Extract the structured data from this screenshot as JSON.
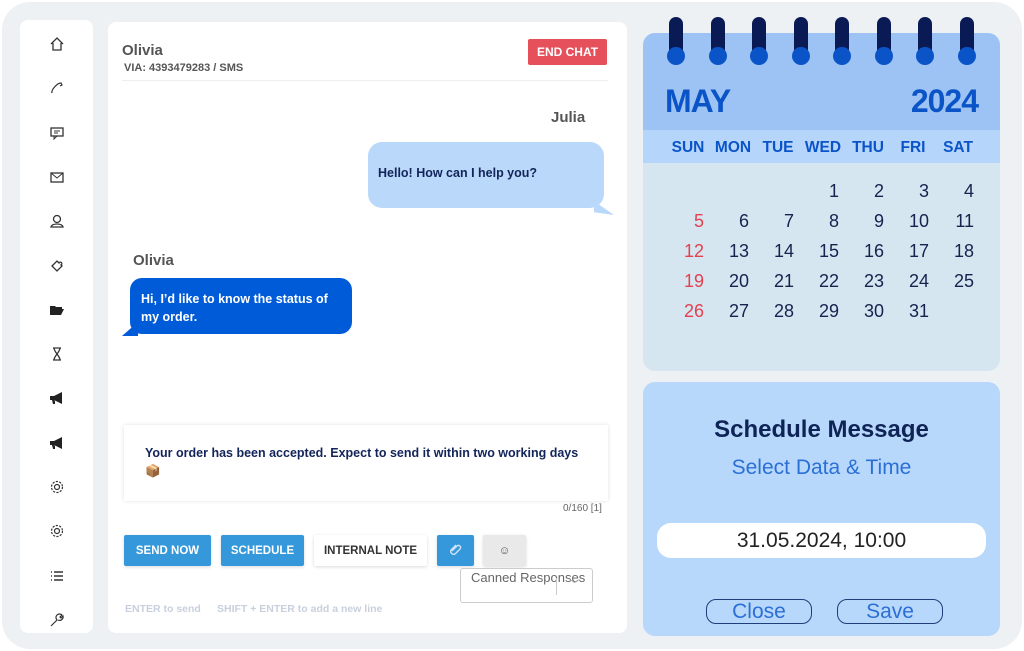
{
  "sidebar": {
    "items": [
      {
        "icon": "home-icon"
      },
      {
        "icon": "phone-icon"
      },
      {
        "icon": "chat-icon"
      },
      {
        "icon": "mail-icon"
      },
      {
        "icon": "user-icon"
      },
      {
        "icon": "puzzle-icon"
      },
      {
        "icon": "folder-open-icon"
      },
      {
        "icon": "hourglass-icon"
      },
      {
        "icon": "megaphone-icon"
      },
      {
        "icon": "megaphone-icon"
      },
      {
        "icon": "gear-icon"
      },
      {
        "icon": "gear-icon"
      },
      {
        "icon": "list-icon"
      },
      {
        "icon": "wrench-icon"
      }
    ]
  },
  "chat": {
    "contact_name": "Olivia",
    "via": "VIA:  4393479283 / SMS",
    "end_chat": "END CHAT",
    "messages": [
      {
        "sender": "Julia",
        "text": "Hello! How can I help you?"
      },
      {
        "sender": "Olivia",
        "text": "Hi, I’d like to know the status of my order."
      }
    ],
    "compose_text": "Your order has been accepted. Expect to send it within two working days📦",
    "counter": "0/160 [1]",
    "send_now": "SEND NOW",
    "schedule": "SCHEDULE",
    "internal_note": "INTERNAL NOTE",
    "canned_responses": "Canned Responses",
    "hint_enter": "ENTER to send",
    "hint_shift": "SHIFT + ENTER to add a new line"
  },
  "calendar": {
    "month": "MAY",
    "year": "2024",
    "weekdays": [
      "SUN",
      "MON",
      "TUE",
      "WED",
      "THU",
      "FRI",
      "SAT"
    ],
    "first_weekday_index": 3,
    "days_in_month": 31,
    "colors": {
      "header": "#9dc3f5",
      "weekday_row": "#b5d5fb",
      "body": "#d6e6f0",
      "sunday": "#e4404f",
      "accent": "#0b54c8"
    }
  },
  "schedule": {
    "title": "Schedule Message",
    "subtitle": "Select Data & Time",
    "datetime": "31.05.2024, 10:00",
    "close": "Close",
    "save": "Save"
  }
}
